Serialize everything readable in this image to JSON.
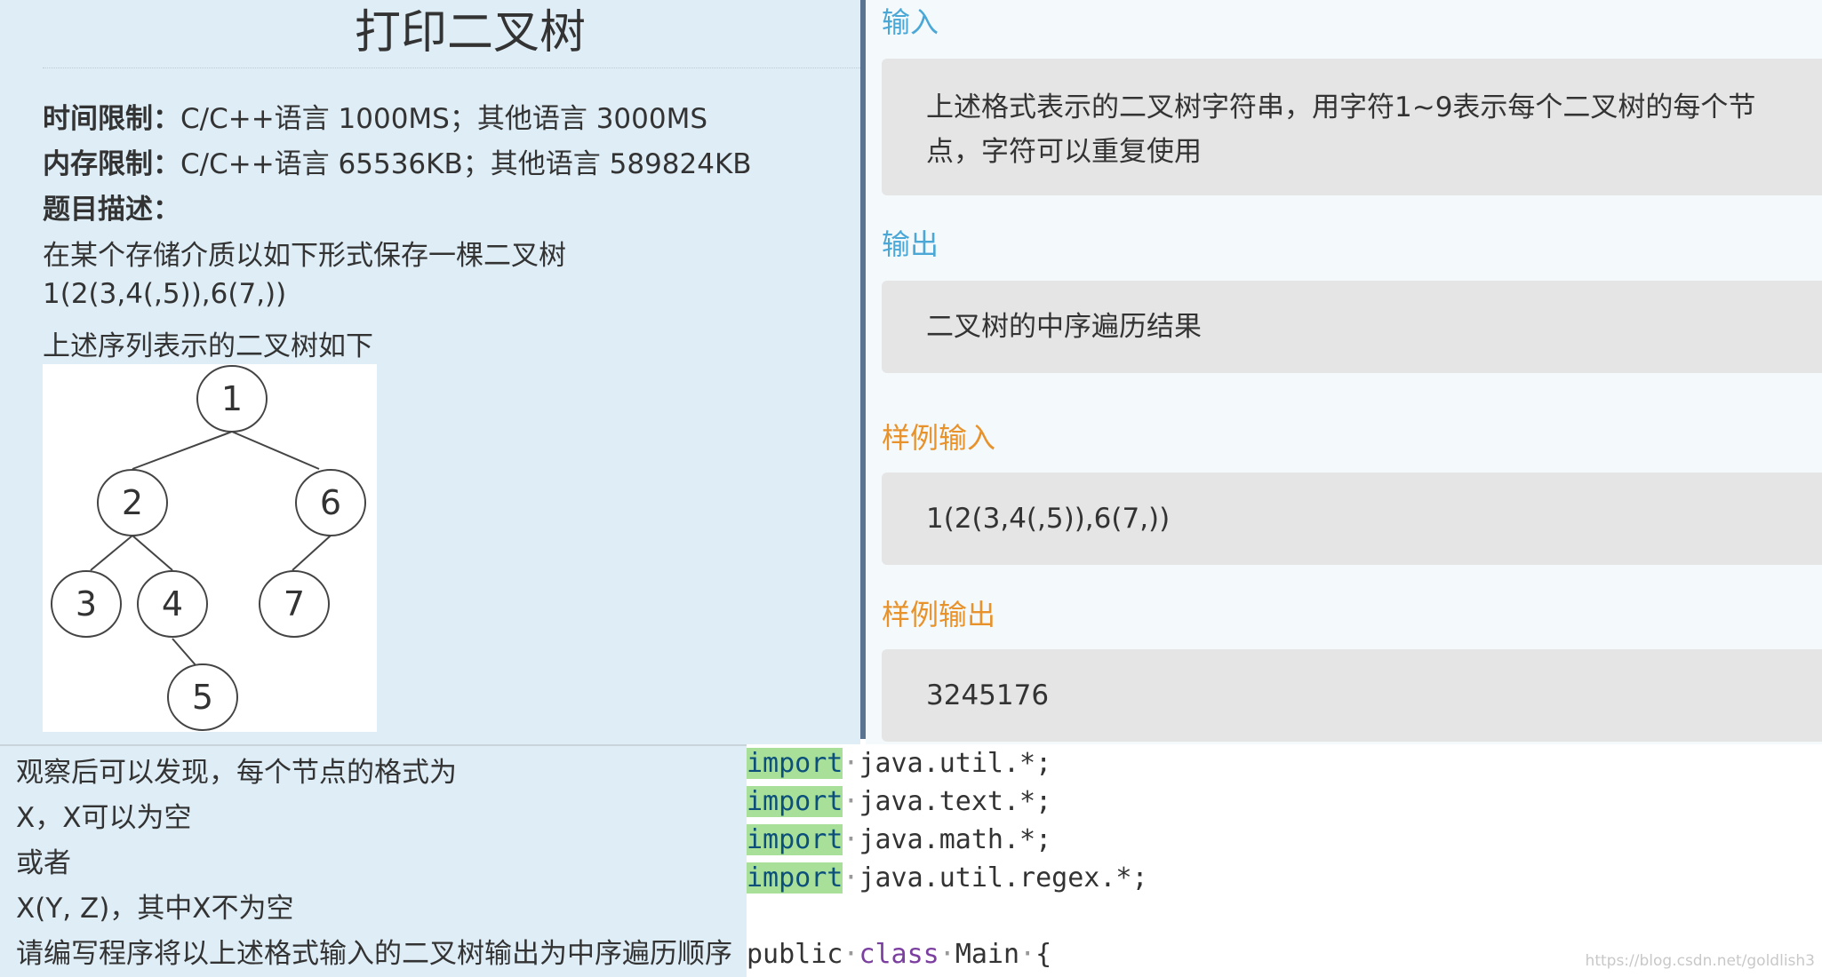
{
  "problem": {
    "title": "打印二叉树",
    "time_label": "时间限制：",
    "time_value": "C/C++语言 1000MS；其他语言 3000MS",
    "memory_label": "内存限制：",
    "memory_value": "C/C++语言 65536KB；其他语言 589824KB",
    "desc_label": "题目描述：",
    "desc_line1": "在某个存储介质以如下形式保存一棵二叉树",
    "desc_line2": "1(2(3,4(,5)),6(7,))",
    "desc_line3": "上述序列表示的二叉树如下"
  },
  "tree": {
    "nodes": [
      "1",
      "2",
      "6",
      "3",
      "4",
      "7",
      "5"
    ]
  },
  "description_cont": {
    "line1": "观察后可以发现，每个节点的格式为",
    "line2": "X，X可以为空",
    "line3": "或者",
    "line4": "X(Y, Z)，其中X不为空",
    "line5": "请编写程序将以上述格式输入的二叉树输出为中序遍历顺序"
  },
  "io": {
    "input_head": "输入",
    "input_text_1": "上述格式表示的二叉树字符串，用字符1~9表示每个二叉树的每个节",
    "input_text_2": "点，字符可以重复使用",
    "output_head": "输出",
    "output_text": "二叉树的中序遍历结果",
    "sample_in_head": "样例输入",
    "sample_in": "1(2(3,4(,5)),6(7,))",
    "sample_out_head": "样例输出",
    "sample_out": "3245176"
  },
  "code": {
    "kw_import": "import",
    "line1_rest": "java.util.*;",
    "line2_rest": "java.text.*;",
    "line3_rest": "java.math.*;",
    "line4_rest": "java.util.regex.*;",
    "line6_a": "public",
    "line6_b": "class",
    "line6_c": "Main",
    "line6_d": "{"
  },
  "watermark": "https://blog.csdn.net/goldlish3"
}
